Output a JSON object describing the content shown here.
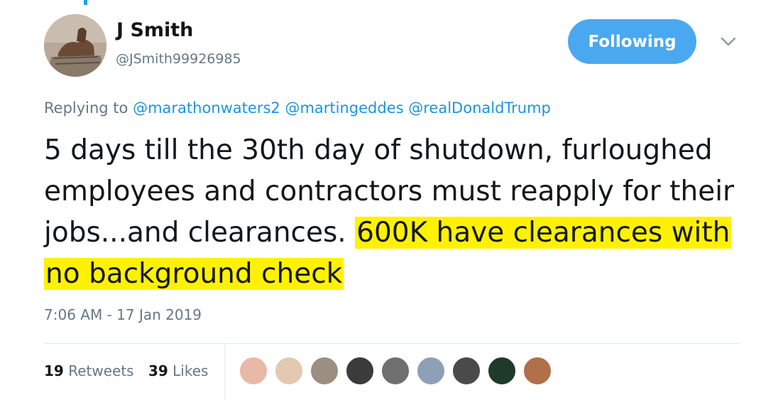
{
  "user": {
    "name": "J Smith",
    "handle": "@JSmith99926985"
  },
  "follow_button": {
    "label": "Following",
    "color": "#4aa8f0"
  },
  "reply": {
    "prefix": "Replying to",
    "mentions": [
      "@marathonwaters2",
      "@martingeddes",
      "@realDonaldTrump"
    ]
  },
  "tweet": {
    "text_plain": "5 days till the 30th day of shutdown, furloughed employees and contractors must reapply for their jobs...and clearances.",
    "text_highlighted": "600K have clearances with no background check",
    "highlight_color": "#fff200"
  },
  "timestamp": "7:06 AM - 17 Jan 2019",
  "stats": {
    "retweets_count": "19",
    "retweets_label": "Retweets",
    "likes_count": "39",
    "likes_label": "Likes"
  },
  "likers": [
    {
      "color": "#e8b9a6"
    },
    {
      "color": "#e2c9b0"
    },
    {
      "color": "#9a8f80"
    },
    {
      "color": "#3b3b3b"
    },
    {
      "color": "#6f6f6f"
    },
    {
      "color": "#8ea0b8"
    },
    {
      "color": "#4a4a4a"
    },
    {
      "color": "#1f3a2a"
    },
    {
      "color": "#b0704a"
    }
  ]
}
